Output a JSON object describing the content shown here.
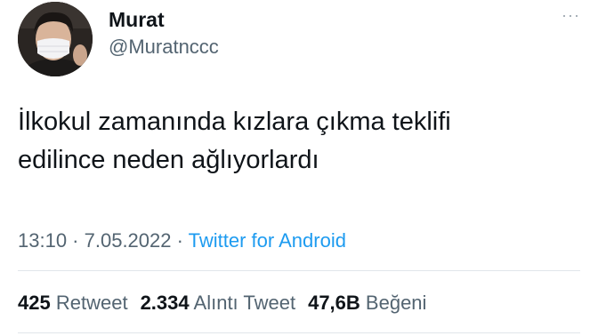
{
  "user": {
    "display_name": "Murat",
    "handle": "@Muratnccc"
  },
  "more_icon": "···",
  "tweet": {
    "text_line1": "İlkokul zamanında kızlara çıkma teklifi",
    "text_line2": "edilince neden ağlıyorlardı"
  },
  "meta": {
    "time": "13:10",
    "sep1": " · ",
    "date": "7.05.2022",
    "sep2": " · ",
    "source": "Twitter for Android"
  },
  "stats": {
    "retweets": "425",
    "retweets_label": "Retweet",
    "quotes": "2.334",
    "quotes_label": "Alıntı Tweet",
    "likes": "47,6B",
    "likes_label": "Beğeni"
  },
  "colors": {
    "text": "#0f1419",
    "secondary": "#536471",
    "link": "#1d9bf0"
  }
}
